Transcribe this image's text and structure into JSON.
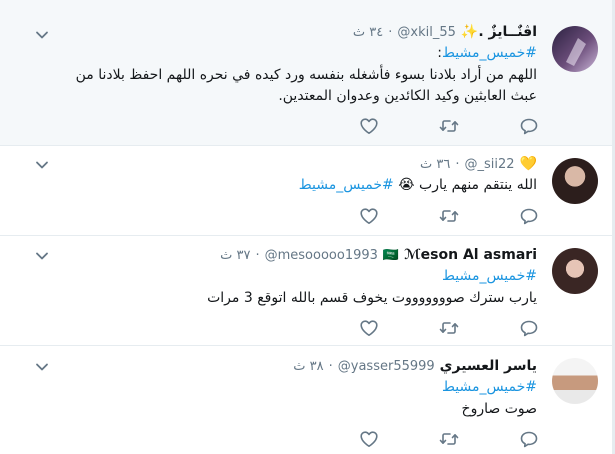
{
  "tweets": [
    {
      "name": "اڤنٌــايزٌ .",
      "name_emoji": "✨",
      "handle": "@xkil_55",
      "time": "٣٤ ث",
      "hashtag": "#خميس_مشيط",
      "hashtag_suffix": ":",
      "text": "اللهم من أراد بلادنا بسوء فأشغله بنفسه ورد كيده في نحره اللهم احفظ بلادنا من عبث العابثين وكيد الكائدين وعدوان المعتدين.",
      "highlighted": true
    },
    {
      "name": "",
      "name_emoji": "💛",
      "handle": "@_sii22",
      "time": "٣٦ ث",
      "hashtag": "#خميس_مشيط",
      "text_prefix": "الله ينتقم منهم يارب 😭",
      "highlighted": false
    },
    {
      "name": "ℳeson Al asmari",
      "name_emoji": "🇸🇦",
      "handle": "@mesooooo1993",
      "time": "٣٧ ث",
      "hashtag": "#خميس_مشيط",
      "text": "يارب سترك صوووووووت يخوف قسم بالله اتوقع 3 مرات",
      "highlighted": false
    },
    {
      "name": "ياسر العسيري",
      "name_emoji": "",
      "handle": "@yasser55999",
      "time": "٣٨ ث",
      "hashtag": "#خميس_مشيط",
      "text": "صوت صاروخ",
      "highlighted": false
    }
  ],
  "icons": {
    "reply": "reply-icon",
    "retweet": "retweet-icon",
    "like": "heart-icon",
    "more": "chevron-down-icon"
  },
  "colors": {
    "hashtag": "#1b95e0",
    "secondary": "#657786",
    "highlight_bg": "#f5f8fa",
    "border": "#e6ecf0"
  }
}
